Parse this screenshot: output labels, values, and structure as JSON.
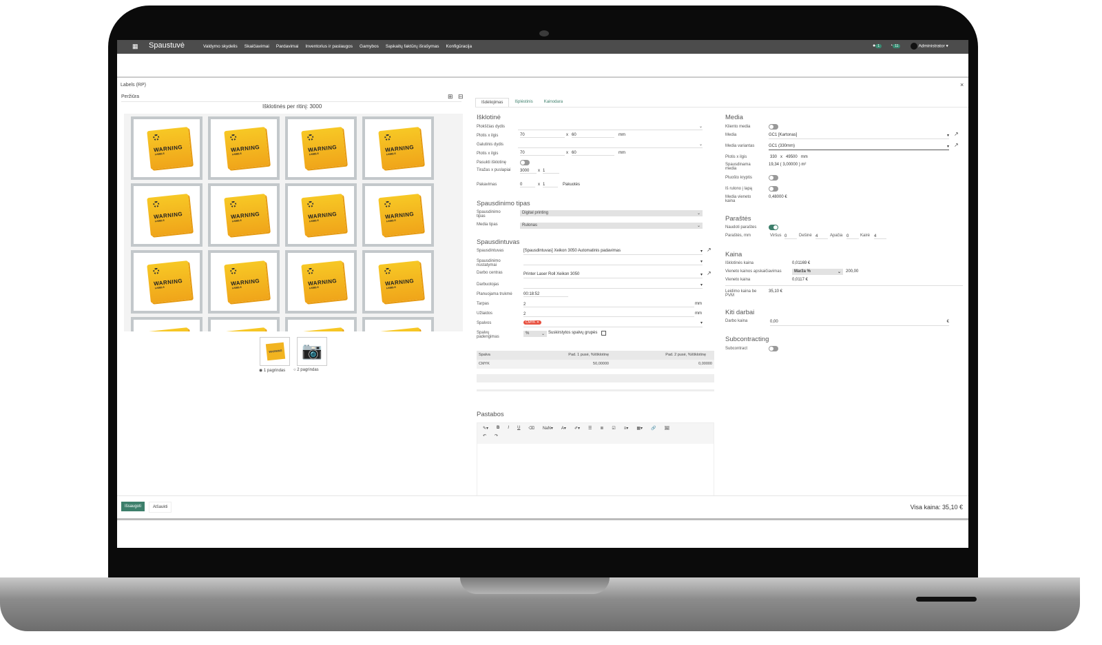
{
  "app": {
    "brand": "Spaustuvė",
    "menu": [
      "Valdymo skydelis",
      "Skaičiavimai",
      "Pardavimai",
      "Inventorius ir paslaugos",
      "Gamybos",
      "Sąskaitų faktūrų išrašymas",
      "Konfigūracija"
    ],
    "messages_count": "1",
    "activities_count": "11",
    "user": "Administrator"
  },
  "dialog": {
    "title": "Labels (RP)",
    "close": "×"
  },
  "preview": {
    "title": "Peržiūra",
    "caption": "Išklotinės per ritinį: 3000",
    "label_text": "WARNING",
    "label_sub": "LABELS",
    "pages": [
      "1 pagrindas",
      "2 pagrindas"
    ],
    "selected_page": 0
  },
  "tabs": [
    "Išdėliojimas",
    "Išplėstinis",
    "Kainodara"
  ],
  "isklotine": {
    "title": "Išklotinė",
    "plokscias": "Plokščias dydis",
    "plotis1": "Plotis x ilgis",
    "w1": "70",
    "l1": "60",
    "galutinis": "Galutinis dydis",
    "plotis2": "Plotis x ilgis",
    "w2": "70",
    "l2": "60",
    "mm": "mm",
    "x": "x",
    "pasukti": "Pasukti išklotinę",
    "pasukti_on": false,
    "tirazas": "Tiražas x puslapiai",
    "tir": "3000",
    "psl": "1",
    "pakavimas": "Pakavimas",
    "pak": "0",
    "pak2": "1",
    "pakuotes": "Pakuotės"
  },
  "spaud_tipas": {
    "title": "Spausdinimo tipas",
    "tipas_label": "Spausdinimo tipas",
    "tipas": "Digital printing",
    "media_label": "Media tipas",
    "media": "Rulonas"
  },
  "spausdintuvas": {
    "title": "Spausdintuvas",
    "sp_label": "Spausdintuvas",
    "sp": "[Spausdintuvas] Xeikon 3050 Automatinis padavimas",
    "nust_label": "Spausdinimo nustatymai",
    "centras_label": "Darbo centras",
    "centras": "Printer Laser Roll Xeikon 3050",
    "darb_label": "Darbuotojas",
    "trukme_label": "Planuojama trukmė",
    "trukme": "00:18:52",
    "tarpas_label": "Tarpas",
    "tarpas": "2",
    "uzlaidos_label": "Užlaidos",
    "uzlaidos": "2",
    "mm": "mm",
    "spalvos_label": "Spalvos",
    "spalva_tag": "CMYK",
    "padengimas_label": "Spalvų padengimas",
    "padengimas": "%",
    "grupes": "Suskirstytos spalvų grupės"
  },
  "color_table": {
    "headers": [
      "Spalva",
      "Pad. 1 pusė, %/išklotinę",
      "Pad. 2 pusė, %/išklotinę"
    ],
    "rows": [
      [
        "CMYK",
        "50,00000",
        "0,00000"
      ]
    ]
  },
  "pastabos": {
    "title": "Pastabos",
    "font_size": "NaN"
  },
  "media": {
    "title": "Media",
    "klient_label": "Kliento media",
    "media_label": "Media",
    "media": "GC1 [Kartonas]",
    "var_label": "Media variantas",
    "variantas": "GC1 (330mm)",
    "pl_label": "Plotis x ilgis",
    "pl": "330",
    "il": "49500",
    "mm": "mm",
    "x": "x",
    "sp_label": "Spausdinama media",
    "sp": "19,34 ( 3,00000 ) m²",
    "pluosto_label": "Pluošto kryptis",
    "rulon_label": "Iš rulono į lapą",
    "kaina_label": "Media vieneto kaina",
    "kaina": "0,48000 €"
  },
  "parastes": {
    "title": "Paraštės",
    "naudoti_label": "Naudoti paraštes",
    "naudoti": true,
    "mm_label": "Paraštės, mm",
    "virsus_l": "Viršus",
    "virsus": "0",
    "desine_l": "Dešinė",
    "desine": "4",
    "apacia_l": "Apačia",
    "apacia": "0",
    "kaire_l": "Kairė",
    "kaire": "4"
  },
  "kaina": {
    "title": "Kaina",
    "isk_label": "Išklotinės kaina",
    "isk": "0,01169 €",
    "apsk_label": "Vieneto kainos apskaičiavimas",
    "apsk": "Marža %",
    "apsk_val": "200,00",
    "vien_label": "Vieneto kaina",
    "vien": "0,0117 €",
    "leid_label": "Leidimo kaina be PVM",
    "leid": "35,10 €"
  },
  "kiti": {
    "title": "Kiti darbai",
    "darbo_label": "Darbo kaina",
    "darbo": "0,00",
    "cur": "€"
  },
  "sub": {
    "title": "Subcontracting",
    "label": "Subcontract"
  },
  "footer": {
    "save": "Išsaugoti",
    "cancel": "Atšaukti",
    "total": "Visa kaina: 35,10 €"
  },
  "colors": {
    "accent": "#3d7f6b",
    "tag": "#e8503f",
    "nav": "#4c4c4c"
  }
}
